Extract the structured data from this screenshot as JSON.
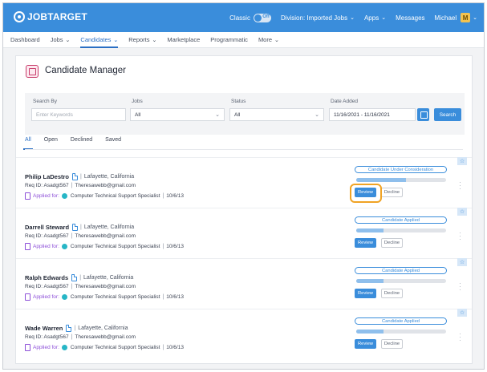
{
  "brand": {
    "name": "JOBTARGET"
  },
  "topnav": {
    "classic_label": "Classic",
    "toggle_state": "Off",
    "division_label": "Division: Imported Jobs",
    "apps_label": "Apps",
    "messages_label": "Messages",
    "user_name": "Michael",
    "user_initial": "M"
  },
  "subnav": [
    "Dashboard",
    "Jobs",
    "Candidates",
    "Reports",
    "Marketplace",
    "Programmatic",
    "More"
  ],
  "subnav_active": "Candidates",
  "page": {
    "title": "Candidate Manager"
  },
  "search": {
    "search_by_label": "Search By",
    "search_by_placeholder": "Enter Keywords",
    "jobs_label": "Jobs",
    "jobs_value": "All",
    "status_label": "Status",
    "status_value": "All",
    "date_label": "Date Added",
    "date_value": "11/16/2021 - 11/16/2021",
    "search_button": "Search"
  },
  "tabs": [
    "All",
    "Open",
    "Declined",
    "Saved"
  ],
  "active_tab": "All",
  "actions": {
    "review": "Review",
    "decline": "Decline"
  },
  "candidates": [
    {
      "name": "Philip LaDestro",
      "location": "Lafayette, California",
      "req_id": "Req ID: Asadgt567",
      "email": "Theresawebb@gmail.com",
      "applied_label": "Applied for:",
      "job": "Computer Technical Support Specialist",
      "date": "10/6/13",
      "status": "Candidate Under Consideration",
      "progress": 0.55
    },
    {
      "name": "Darrell Steward",
      "location": "Lafayette, California",
      "req_id": "Req ID: Asadgt567",
      "email": "Theresawebb@gmail.com",
      "applied_label": "Applied for:",
      "job": "Computer Technical Support Specialist",
      "date": "10/6/13",
      "status": "Candidate Applied",
      "progress": 0.3
    },
    {
      "name": "Ralph Edwards",
      "location": "Lafayette, California",
      "req_id": "Req ID: Asadgt567",
      "email": "Theresawebb@gmail.com",
      "applied_label": "Applied for:",
      "job": "Computer Technical Support Specialist",
      "date": "10/6/13",
      "status": "Candidate Applied",
      "progress": 0.3
    },
    {
      "name": "Wade Warren",
      "location": "Lafayette, California",
      "req_id": "Req ID: Asadgt567",
      "email": "Theresawebb@gmail.com",
      "applied_label": "Applied for:",
      "job": "Computer Technical Support Specialist",
      "date": "10/6/13",
      "status": "Candidate Applied",
      "progress": 0.3
    }
  ],
  "colors": {
    "primary": "#3a8ddb",
    "highlight": "#f0a324",
    "applied": "#8d4fd8"
  }
}
